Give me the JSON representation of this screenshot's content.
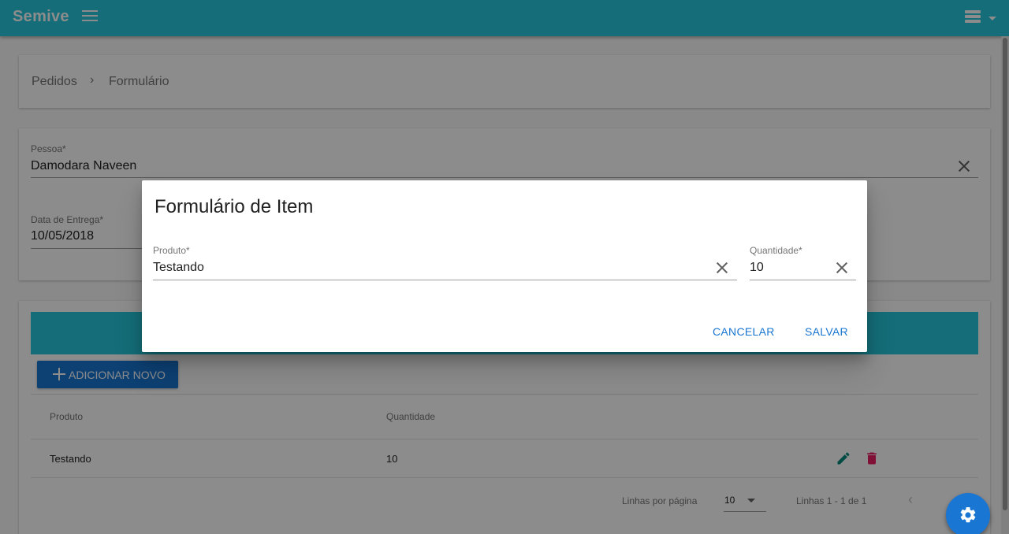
{
  "app": {
    "brand": "Semive"
  },
  "breadcrumb": {
    "items": [
      "Pedidos",
      "Formulário"
    ],
    "separator": "›"
  },
  "order_form": {
    "person": {
      "label": "Pessoa*",
      "value": "Damodara Naveen"
    },
    "delivery_date": {
      "label": "Data de Entrega*",
      "value": "10/05/2018"
    }
  },
  "items_table": {
    "add_button": "ADICIONAR NOVO",
    "columns": [
      "Produto",
      "Quantidade"
    ],
    "rows": [
      {
        "product": "Testando",
        "quantity": "10"
      }
    ],
    "footer": {
      "rows_per_page_label": "Linhas por página",
      "rows_per_page_value": "10",
      "range": "Linhas 1 - 1 de 1",
      "prev": "‹"
    }
  },
  "dialog": {
    "title": "Formulário de Item",
    "product": {
      "label": "Produto*",
      "value": "Testando"
    },
    "quantity": {
      "label": "Quantidade*",
      "value": "10"
    },
    "cancel_label": "CANCELAR",
    "save_label": "SALVAR"
  },
  "colors": {
    "toolbar": "#26c6da",
    "primary": "#1976d2",
    "edit": "#00897b",
    "delete": "#e91e63"
  },
  "icons": [
    "menu-icon",
    "view-list-icon",
    "close-icon",
    "add-icon",
    "pencil-icon",
    "trash-icon",
    "chevron-left-icon",
    "gear-icon"
  ]
}
